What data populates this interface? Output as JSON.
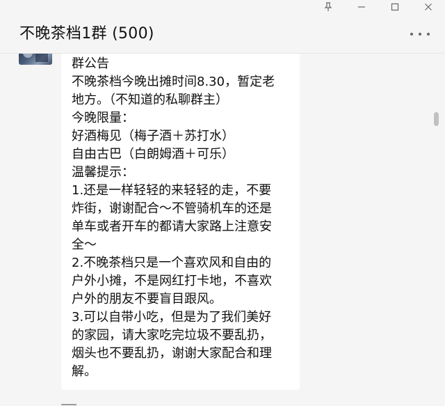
{
  "window": {
    "controls": [
      {
        "icon": "pin-icon"
      },
      {
        "icon": "minimize-icon"
      },
      {
        "icon": "maximize-icon"
      },
      {
        "icon": "close-icon"
      }
    ]
  },
  "header": {
    "title": "不晚茶档1群 (500)",
    "more_icon": "more-options-icon"
  },
  "message": {
    "lines": [
      "群公告",
      "不晚茶档今晚出摊时间8.30，暂定老",
      "地方。（不知道的私聊群主）",
      "今晚限量：",
      "好酒梅见（梅子酒＋苏打水）",
      "自由古巴（白朗姆酒＋可乐）",
      "温馨提示：",
      "1.还是一样轻轻的来轻轻的走，不要",
      "炸街，谢谢配合～不管骑机车的还是",
      "单车或者开车的都请大家路上注意安",
      "全～",
      "2.不晚茶档只是一个喜欢风和自由的",
      "户外小摊，不是网红打卡地，不喜欢",
      "户外的朋友不要盲目跟风。",
      "3.可以自带小吃，但是为了我们美好",
      "的家园，请大家吃完垃圾不要乱扔，",
      "烟头也不要乱扔，谢谢大家配合和理",
      "解。"
    ]
  },
  "colors": {
    "background": "#f5f5f5",
    "bubble": "#ffffff",
    "text": "#111111"
  }
}
